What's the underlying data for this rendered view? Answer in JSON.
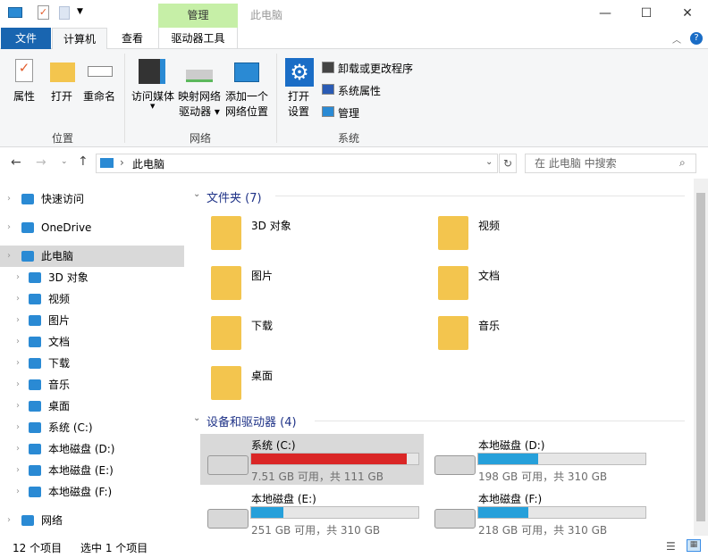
{
  "window": {
    "title": "此电脑",
    "context_tab": "管理",
    "minimize": "—",
    "maximize": "☐",
    "close": "✕"
  },
  "tabs": [
    {
      "label": "文件"
    },
    {
      "label": "计算机"
    },
    {
      "label": "查看"
    },
    {
      "label": "驱动器工具"
    }
  ],
  "ribbon": {
    "location": {
      "label": "位置",
      "buttons": [
        "属性",
        "打开",
        "重命名"
      ]
    },
    "network": {
      "label": "网络",
      "media": "访问媒体",
      "map1": "映射网络",
      "map2": "驱动器",
      "add1": "添加一个",
      "add2": "网络位置"
    },
    "system": {
      "label": "系统",
      "open1": "打开",
      "open2": "设置",
      "uninstall": "卸载或更改程序",
      "props": "系统属性",
      "manage": "管理"
    }
  },
  "address": {
    "path": "此电脑",
    "search_placeholder": "在 此电脑 中搜索"
  },
  "nav": [
    {
      "label": "快速访问",
      "level": 0
    },
    {
      "label": "OneDrive",
      "level": 0
    },
    {
      "label": "此电脑",
      "level": 0,
      "selected": true
    },
    {
      "label": "3D 对象",
      "level": 1
    },
    {
      "label": "视频",
      "level": 1
    },
    {
      "label": "图片",
      "level": 1
    },
    {
      "label": "文档",
      "level": 1
    },
    {
      "label": "下载",
      "level": 1
    },
    {
      "label": "音乐",
      "level": 1
    },
    {
      "label": "桌面",
      "level": 1
    },
    {
      "label": "系统 (C:)",
      "level": 1
    },
    {
      "label": "本地磁盘 (D:)",
      "level": 1
    },
    {
      "label": "本地磁盘 (E:)",
      "level": 1
    },
    {
      "label": "本地磁盘 (F:)",
      "level": 1
    },
    {
      "label": "网络",
      "level": 0
    }
  ],
  "folders": {
    "header": "文件夹 (7)",
    "items": [
      "3D 对象",
      "视频",
      "图片",
      "文档",
      "下载",
      "音乐",
      "桌面"
    ]
  },
  "drives": {
    "header": "设备和驱动器 (4)",
    "items": [
      {
        "name": "系统 (C:)",
        "info": "7.51 GB 可用，共 111 GB",
        "used_pct": 93,
        "color": "#da2626"
      },
      {
        "name": "本地磁盘 (D:)",
        "info": "198 GB 可用，共 310 GB",
        "used_pct": 36,
        "color": "#26a0da"
      },
      {
        "name": "本地磁盘 (E:)",
        "info": "251 GB 可用，共 310 GB",
        "used_pct": 19,
        "color": "#26a0da"
      },
      {
        "name": "本地磁盘 (F:)",
        "info": "218 GB 可用，共 310 GB",
        "used_pct": 30,
        "color": "#26a0da"
      }
    ]
  },
  "status": {
    "count": "12 个项目",
    "selected": "选中 1 个项目"
  }
}
